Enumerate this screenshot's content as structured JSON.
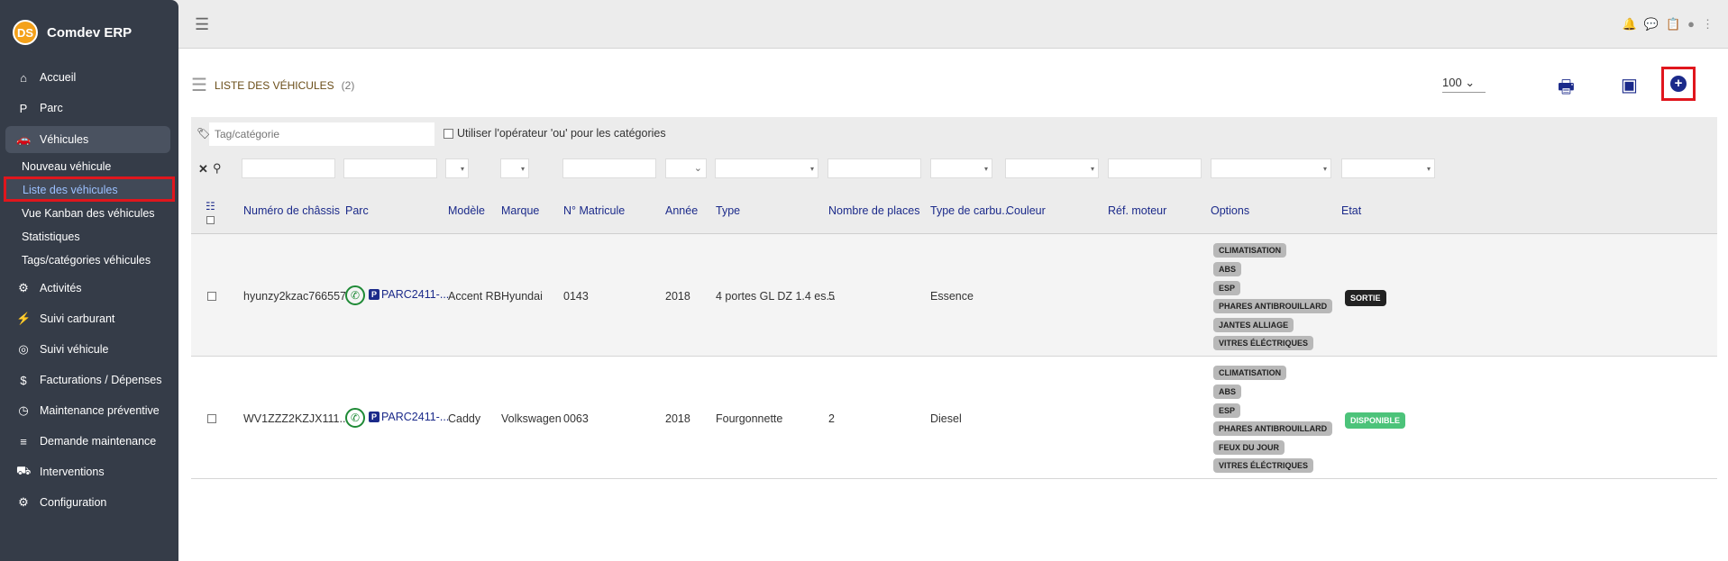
{
  "app": {
    "logo_text": "DS",
    "title": "Comdev ERP"
  },
  "nav": {
    "items": [
      {
        "icon": "home-icon",
        "glyph": "⌂",
        "label": "Accueil"
      },
      {
        "icon": "parking-icon",
        "glyph": "P",
        "label": "Parc"
      },
      {
        "icon": "car-icon",
        "glyph": "🚗",
        "label": "Véhicules"
      }
    ],
    "sub": [
      "Nouveau véhicule",
      "Liste des véhicules",
      "Vue Kanban des véhicules",
      "Statistiques",
      "Tags/catégories véhicules"
    ],
    "more": [
      {
        "icon": "activities-icon",
        "glyph": "⚙",
        "label": "Activités"
      },
      {
        "icon": "fuel-icon",
        "glyph": "⚡",
        "label": "Suivi carburant"
      },
      {
        "icon": "binoculars-icon",
        "glyph": "◎",
        "label": "Suivi véhicule"
      },
      {
        "icon": "invoice-icon",
        "glyph": "$",
        "label": "Facturations / Dépenses"
      },
      {
        "icon": "clock-icon",
        "glyph": "◷",
        "label": "Maintenance préventive"
      },
      {
        "icon": "list-icon",
        "glyph": "≡",
        "label": "Demande maintenance"
      },
      {
        "icon": "truck-icon",
        "glyph": "⛟",
        "label": "Interventions"
      },
      {
        "icon": "cogs-icon",
        "glyph": "⚙",
        "label": "Configuration"
      }
    ]
  },
  "page": {
    "title": "LISTE DES VÉHICULES",
    "count": "(2)",
    "per_page": "100 ⌄"
  },
  "filters": {
    "tag_placeholder": "Tag/catégorie",
    "ou_label": "Utiliser l'opérateur 'ou' pour les catégories"
  },
  "columns": [
    "Numéro de châssis",
    "Parc",
    "Modèle",
    "Marque",
    "N° Matricule",
    "Année",
    "Type",
    "Nombre de places",
    "Type de carbu...",
    "Couleur",
    "Réf. moteur",
    "Options",
    "Etat"
  ],
  "rows": [
    {
      "chassis": "hyunzy2kzac766557",
      "parc": "PARC2411-...",
      "modele": "Accent RB",
      "marque": "Hyundai",
      "matricule": "0143",
      "annee": "2018",
      "type": "4 portes GL DZ 1.4 es...",
      "places": "5",
      "carburant": "Essence",
      "options": [
        "CLIMATISATION",
        "ABS",
        "ESP",
        "PHARES ANTIBROUILLARD",
        "JANTES ALLIAGE",
        "VITRES ÉLÉCTRIQUES"
      ],
      "etat": "SORTIE",
      "etat_color": "#222222"
    },
    {
      "chassis": "WV1ZZZ2KZJX111...",
      "parc": "PARC2411-...",
      "modele": "Caddy",
      "marque": "Volkswagen",
      "matricule": "0063",
      "annee": "2018",
      "type": "Fourgonnette",
      "places": "2",
      "carburant": "Diesel",
      "options": [
        "CLIMATISATION",
        "ABS",
        "ESP",
        "PHARES ANTIBROUILLARD",
        "FEUX DU JOUR",
        "VITRES ÉLÉCTRIQUES"
      ],
      "etat": "DISPONIBLE",
      "etat_color": "#4cc37a"
    }
  ]
}
